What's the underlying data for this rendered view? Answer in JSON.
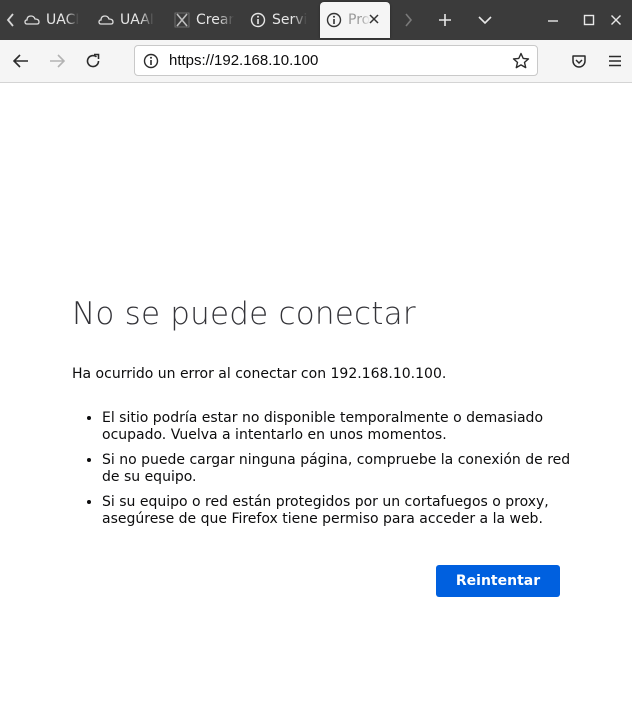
{
  "browser": {
    "tabs": [
      {
        "label": "UACI",
        "icon": "cloud-icon"
      },
      {
        "label": "UAAI",
        "icon": "cloud-icon"
      },
      {
        "label": "Crear",
        "icon": "x-logo-icon"
      },
      {
        "label": "Servi",
        "icon": "info-icon"
      },
      {
        "label": "Pro",
        "icon": "info-icon",
        "active": true
      }
    ],
    "url": "https://192.168.10.100"
  },
  "error_page": {
    "title": "No se puede conectar",
    "description": "Ha ocurrido un error al conectar con 192.168.10.100.",
    "bullets": [
      "El sitio podría estar no disponible temporalmente o demasiado ocupado. Vuelva a intentarlo en unos momentos.",
      "Si no puede cargar ninguna página, compruebe la conexión de red de su equipo.",
      "Si su equipo o red están protegidos por un cortafuegos o proxy, asegúrese de que Firefox tiene permiso para acceder a la web."
    ],
    "retry_label": "Reintentar"
  },
  "colors": {
    "titlebar_bg": "#3b3b3b",
    "toolbar_bg": "#f5f5f5",
    "accent": "#0060df"
  }
}
